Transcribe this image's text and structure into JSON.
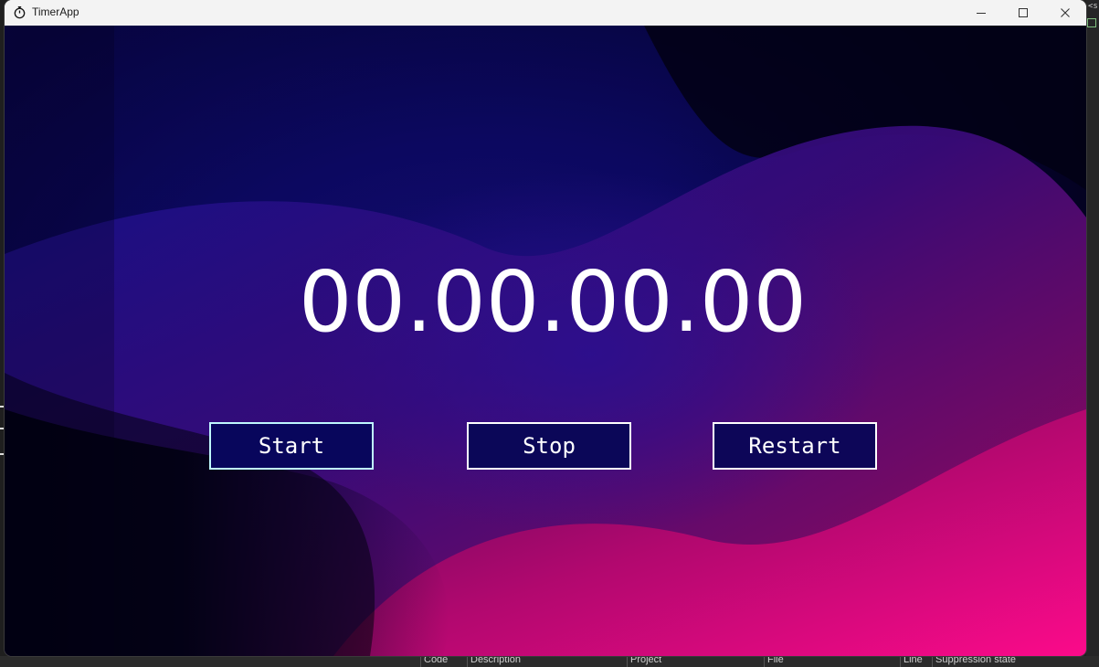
{
  "window": {
    "title": "TimerApp",
    "icon": "stopwatch-icon",
    "controls": [
      "minimize-icon",
      "maximize-icon",
      "close-icon"
    ]
  },
  "timer": {
    "display": "00.00.00.00"
  },
  "buttons": {
    "start_label": "Start",
    "stop_label": "Stop",
    "restart_label": "Restart"
  },
  "background_ide": {
    "right_fragment": "<s",
    "bottom_columns": [
      "Code",
      "Description",
      "Project",
      "File",
      "Line",
      "Suppression state"
    ]
  },
  "colors": {
    "background_dark": "#06033a",
    "background_blue": "#14106e",
    "background_pink": "#ff0a8c",
    "button_fill": "#05055a",
    "button_border": "#ffffff",
    "text": "#ffffff"
  }
}
